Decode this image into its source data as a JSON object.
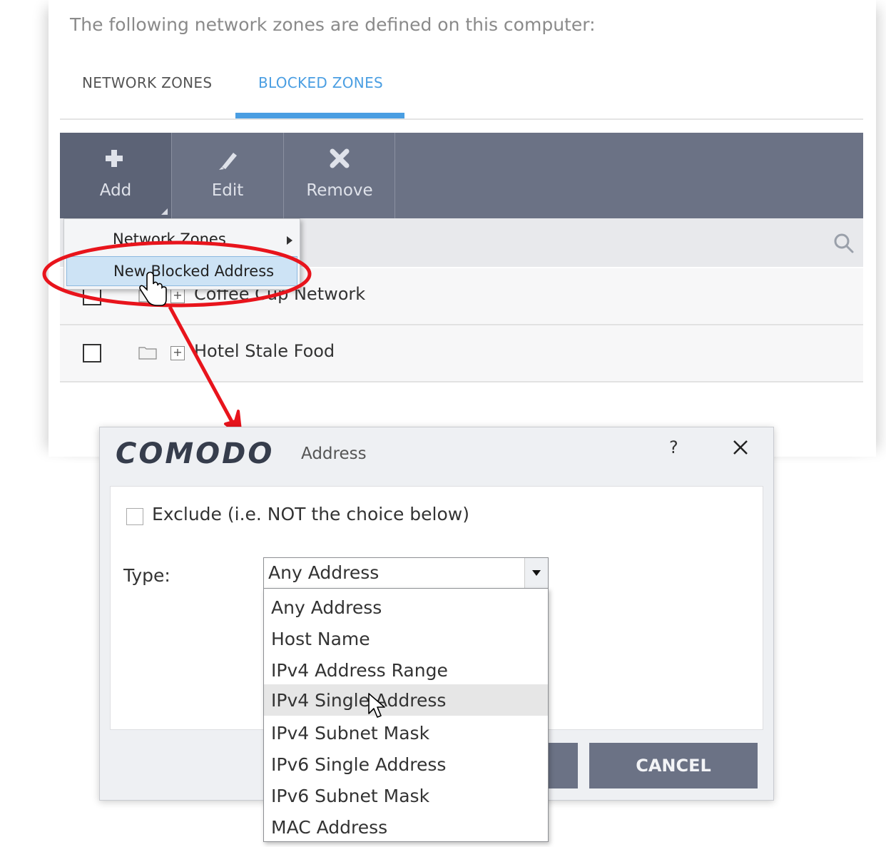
{
  "intro_text": "The following network zones are defined on this computer:",
  "tabs": [
    {
      "label": "NETWORK ZONES"
    },
    {
      "label": "BLOCKED ZONES",
      "active": true
    }
  ],
  "toolbar": {
    "add_label": "Add",
    "edit_label": "Edit",
    "remove_label": "Remove"
  },
  "context_menu": {
    "items": [
      {
        "label": "Network Zones",
        "has_submenu": true
      },
      {
        "label": "New Blocked Address",
        "highlighted": true
      }
    ]
  },
  "zones": [
    {
      "name": "Coffee Cup Network"
    },
    {
      "name": "Hotel Stale Food"
    }
  ],
  "dialog": {
    "brand": "COMODO",
    "title": "Address",
    "help_label": "?",
    "exclude_label": "Exclude (i.e. NOT the choice below)",
    "type_label": "Type:",
    "type_selected": "Any Address",
    "type_options": [
      "Any Address",
      "Host Name",
      "IPv4 Address Range",
      "IPv4 Single Address",
      "IPv4 Subnet Mask",
      "IPv6 Single Address",
      "IPv6 Subnet Mask",
      "MAC Address"
    ],
    "highlighted_option": "IPv4 Single Address",
    "cancel_label": "CANCEL"
  },
  "colors": {
    "accent": "#4a9ee2",
    "toolbar": "#6b7285",
    "annotation": "#e8141c"
  }
}
